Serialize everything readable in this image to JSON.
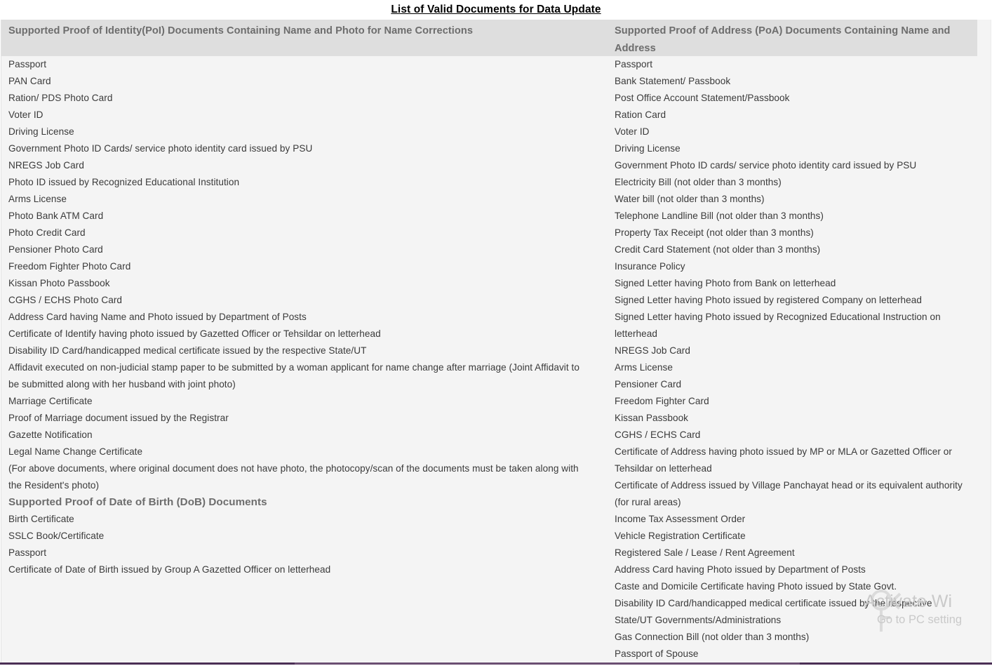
{
  "document": {
    "title": "List of Valid Documents for Data Update",
    "background_color": "#f4f4f4",
    "header_band_color": "#dedede",
    "header_text_color": "#6d6d6d",
    "body_text_color": "#3a3a3a",
    "bottom_rule_color": "#4b2f55"
  },
  "columns": {
    "poi": {
      "header": "Supported Proof of Identity(PoI) Documents Containing Name and Photo for Name Corrections",
      "items": [
        "Passport",
        "PAN Card",
        "Ration/ PDS Photo Card",
        "Voter ID",
        "Driving License",
        "Government Photo ID Cards/ service photo identity card issued by PSU",
        "NREGS Job Card",
        "Photo ID issued by Recognized Educational Institution",
        "Arms License",
        "Photo Bank ATM Card",
        "Photo Credit Card",
        "Pensioner Photo Card",
        "Freedom Fighter Photo Card",
        "Kissan Photo Passbook",
        "CGHS / ECHS Photo Card",
        "Address Card having Name and Photo issued by Department of Posts",
        "Certificate of Identify having photo issued by Gazetted Officer or Tehsildar on letterhead",
        "Disability ID Card/handicapped medical certificate issued by the respective State/UT",
        "Affidavit executed on non-judicial stamp paper to be submitted by a woman applicant for name change after marriage (Joint Affidavit to",
        "be submitted along with her husband with joint photo)",
        "Marriage Certificate",
        "Proof of Marriage document issued by the Registrar",
        "Gazette Notification",
        "Legal Name Change Certificate",
        "(For above documents, where original document does not have photo, the photocopy/scan of the documents must be taken along with",
        "the Resident's photo)"
      ],
      "dob_section": {
        "header": "Supported Proof of Date of Birth (DoB) Documents",
        "items": [
          "Birth Certificate",
          "SSLC Book/Certificate",
          "Passport",
          "Certificate of Date of Birth issued by Group A Gazetted Officer on letterhead"
        ]
      }
    },
    "poa": {
      "header": "Supported Proof of Address (PoA) Documents Containing Name and Address",
      "items": [
        "Passport",
        "Bank Statement/ Passbook",
        "Post Office Account Statement/Passbook",
        "Ration Card",
        "Voter ID",
        "Driving License",
        "Government Photo ID cards/ service photo identity card issued by PSU",
        "Electricity Bill (not older than 3 months)",
        "Water bill (not older than 3 months)",
        "Telephone Landline Bill (not older than 3 months)",
        "Property Tax Receipt (not older than 3 months)",
        "Credit Card Statement (not older than 3 months)",
        "Insurance Policy",
        "Signed Letter having Photo from Bank on letterhead",
        "Signed Letter having Photo issued by registered Company on letterhead",
        "Signed Letter having Photo issued by Recognized Educational Instruction on letterhead",
        "NREGS Job Card",
        "Arms License",
        "Pensioner Card",
        "Freedom Fighter Card",
        "Kissan Passbook",
        "CGHS / ECHS Card",
        "Certificate of Address having photo issued by MP or MLA or Gazetted Officer or Tehsildar on letterhead",
        "Certificate of Address issued by Village Panchayat head or its equivalent authority (for rural areas)",
        "Income Tax Assessment Order",
        "Vehicle Registration Certificate",
        "Registered Sale / Lease / Rent Agreement",
        "Address Card having Photo issued by Department of Posts",
        "Caste and Domicile Certificate having Photo issued by State Govt.",
        "Disability ID Card/handicapped medical certificate issued by the respective State/UT Governments/Administrations",
        "Gas Connection Bill (not older than 3 months)",
        "Passport of Spouse"
      ]
    }
  },
  "watermark": {
    "line1": "Activate Wi",
    "line2": "Go to PC setting",
    "color": "#c9c9c9",
    "icon": "windows-key-icon"
  }
}
